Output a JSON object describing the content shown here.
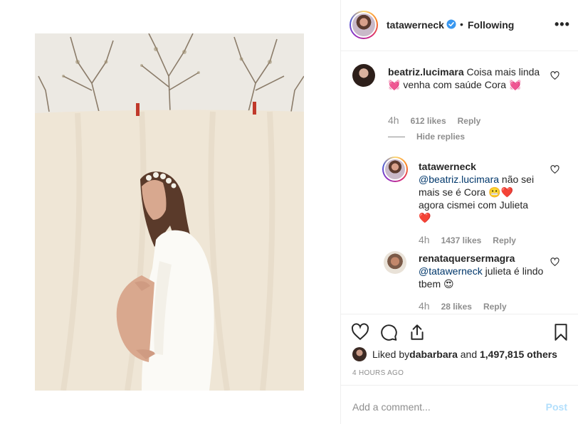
{
  "post": {
    "username": "tatawerneck",
    "separator": "•",
    "follow_status": "Following",
    "more": "•••"
  },
  "comments": [
    {
      "username": "beatriz.lucimara",
      "text": "Coisa mais linda 💓 venha com saúde Cora 💓",
      "time": "4h",
      "likes": "612 likes",
      "reply": "Reply",
      "hide_replies": "Hide replies",
      "replies": [
        {
          "username": "tatawerneck",
          "mention": "@beatriz.lucimara",
          "text": " não sei mais se é Cora 😬❤️ agora cismei com Julieta ❤️",
          "time": "4h",
          "likes": "1437 likes",
          "reply": "Reply"
        },
        {
          "username": "renataquersermagra",
          "mention": "@tatawerneck",
          "text": " julieta é lindo tbem 😍",
          "time": "4h",
          "likes": "28 likes",
          "reply": "Reply"
        }
      ]
    }
  ],
  "likes_line": {
    "prefix": "Liked by ",
    "first_user": "dabarbara",
    "connector": " and ",
    "count": "1,497,815 others"
  },
  "timestamp": "4 HOURS AGO",
  "add_comment": {
    "placeholder": "Add a comment...",
    "post_label": "Post"
  },
  "icons": [
    "verified-badge-icon",
    "more-icon",
    "heart-icon",
    "comment-icon",
    "share-icon",
    "bookmark-icon"
  ],
  "colors": {
    "accent": "#3897f0",
    "mention": "#00376b",
    "muted": "#8e8e8e",
    "post_disabled": "#b2dffc"
  }
}
